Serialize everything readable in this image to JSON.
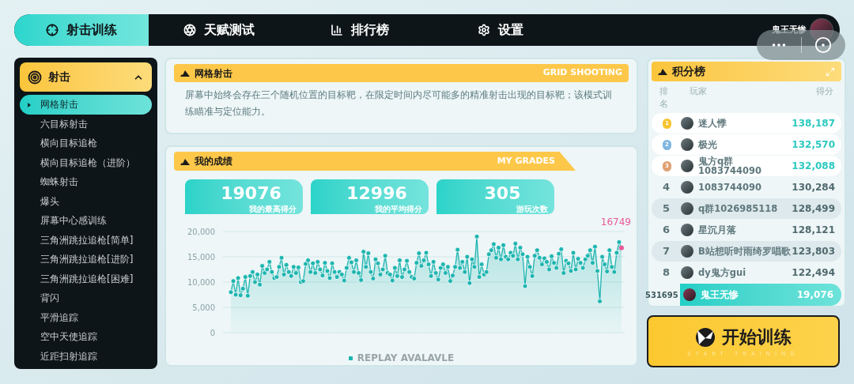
{
  "nav": {
    "tabs": [
      {
        "label": "射击训练",
        "selected": true
      },
      {
        "label": "天赋测试",
        "selected": false
      },
      {
        "label": "排行榜",
        "selected": false
      },
      {
        "label": "设置",
        "selected": false
      }
    ],
    "username": "鬼王无惨"
  },
  "sidebar": {
    "group": {
      "label": "射击",
      "expanded": true
    },
    "items": [
      {
        "label": "网格射击",
        "selected": true
      },
      {
        "label": "六目标射击",
        "selected": false
      },
      {
        "label": "横向目标追枪",
        "selected": false
      },
      {
        "label": "横向目标追枪（进阶）",
        "selected": false
      },
      {
        "label": "蜘蛛射击",
        "selected": false
      },
      {
        "label": "爆头",
        "selected": false
      },
      {
        "label": "屏幕中心感训练",
        "selected": false
      },
      {
        "label": "三角洲跳拉追枪[简单]",
        "selected": false
      },
      {
        "label": "三角洲跳拉追枪[进阶]",
        "selected": false
      },
      {
        "label": "三角洲跳拉追枪[困难]",
        "selected": false
      },
      {
        "label": "背闪",
        "selected": false
      },
      {
        "label": "平滑追踪",
        "selected": false
      },
      {
        "label": "空中天使追踪",
        "selected": false
      },
      {
        "label": "近距扫射追踪",
        "selected": false
      }
    ]
  },
  "mode_card": {
    "title": "网格射击",
    "subtitle": "GRID SHOOTING",
    "description": "屏幕中始终会存在三个随机位置的目标靶，在限定时间内尽可能多的精准射击出现的目标靶；该模式训练瞄准与定位能力。"
  },
  "grades": {
    "title": "我的成绩",
    "subtitle": "MY GRADES",
    "stats": [
      {
        "value": "19076",
        "label": "我的最高得分"
      },
      {
        "value": "12996",
        "label": "我的平均得分"
      },
      {
        "value": "305",
        "label": "游玩次数"
      }
    ],
    "chart_data": {
      "type": "area",
      "grid": true,
      "yticks": [
        {
          "value": 0,
          "label": "0"
        },
        {
          "value": 5000,
          "label": "5,000"
        },
        {
          "value": 10000,
          "label": "10,000"
        },
        {
          "value": 15000,
          "label": "15,000"
        },
        {
          "value": 20000,
          "label": "20,000"
        }
      ],
      "ylim": [
        0,
        20000
      ],
      "annotations": [
        {
          "text": "16749"
        }
      ],
      "series": [
        {
          "name": "REPLAY AVALAVLE",
          "color": "#1fb5b0",
          "marker": "circle",
          "values": [
            8000,
            10200,
            7500,
            10800,
            7400,
            8700,
            11000,
            7300,
            11200,
            12000,
            10000,
            11500,
            9500,
            13200,
            11800,
            12500,
            14000,
            12000,
            10800,
            11000,
            13000,
            14800,
            11500,
            13400,
            12000,
            11200,
            13000,
            11800,
            12900,
            10000,
            10200,
            13600,
            14300,
            12000,
            13700,
            11800,
            14000,
            12500,
            11300,
            13800,
            12200,
            10800,
            13700,
            12000,
            11000,
            12000,
            11500,
            10300,
            12800,
            14800,
            13900,
            12000,
            14300,
            11800,
            10400,
            16000,
            13000,
            15700,
            12000,
            10700,
            14500,
            13700,
            11500,
            12500,
            15200,
            11800,
            11500,
            10300,
            12800,
            11200,
            14300,
            11000,
            12500,
            14200,
            12000,
            11000,
            10700,
            13800,
            15700,
            13200,
            14300,
            15800,
            13500,
            11200,
            14000,
            11800,
            10500,
            12800,
            13500,
            11800,
            13000,
            10200,
            11300,
            13000,
            16400,
            12800,
            14000,
            12000,
            15000,
            9800,
            14500,
            13000,
            19000,
            11000,
            13500,
            11500,
            12000,
            15500,
            16300,
            17500,
            14800,
            16800,
            14500,
            17300,
            15000,
            14500,
            15800,
            15200,
            17600,
            14500,
            16800,
            15500,
            9200,
            15000,
            13000,
            11200,
            15200,
            16300,
            14800,
            13500,
            14700,
            14000,
            12500,
            15100,
            13800,
            12800,
            15600,
            16500,
            11800,
            14200,
            13700,
            12200,
            15800,
            12500,
            14600,
            13800,
            12800,
            14500,
            15200,
            16300,
            13800,
            17000,
            12200,
            6200,
            15000,
            13500,
            12100,
            16300,
            13000,
            12000,
            15800,
            17900,
            16749
          ]
        }
      ]
    }
  },
  "leaderboard": {
    "title": "积分榜",
    "columns": [
      "排名",
      "玩家",
      "得分"
    ],
    "rows": [
      {
        "kind": "medal",
        "rank": "1",
        "color": "#f5c431",
        "name": "迷人悸",
        "score": "138,187"
      },
      {
        "kind": "medal",
        "rank": "2",
        "color": "#7fb6e0",
        "name": "极光",
        "score": "132,570"
      },
      {
        "kind": "medal",
        "rank": "3",
        "color": "#e0a071",
        "name": "鬼方q群1083744090",
        "score": "132,088"
      },
      {
        "kind": "number",
        "rank": "4",
        "name": "1083744090",
        "score": "130,284"
      },
      {
        "kind": "number",
        "rank": "5",
        "name": "q群1026985118",
        "score": "128,499"
      },
      {
        "kind": "number",
        "rank": "6",
        "name": "星沉月落",
        "score": "128,121"
      },
      {
        "kind": "number",
        "rank": "7",
        "name": "B站想听时雨绮罗唱歌",
        "score": "123,803"
      },
      {
        "kind": "number",
        "rank": "8",
        "name": "dy鬼方gui",
        "score": "122,494"
      }
    ],
    "me": {
      "rank": "531695",
      "name": "鬼王无惨",
      "score": "19,076"
    }
  },
  "start_button": {
    "label": "开始训练",
    "caption": "START TRAINING"
  }
}
